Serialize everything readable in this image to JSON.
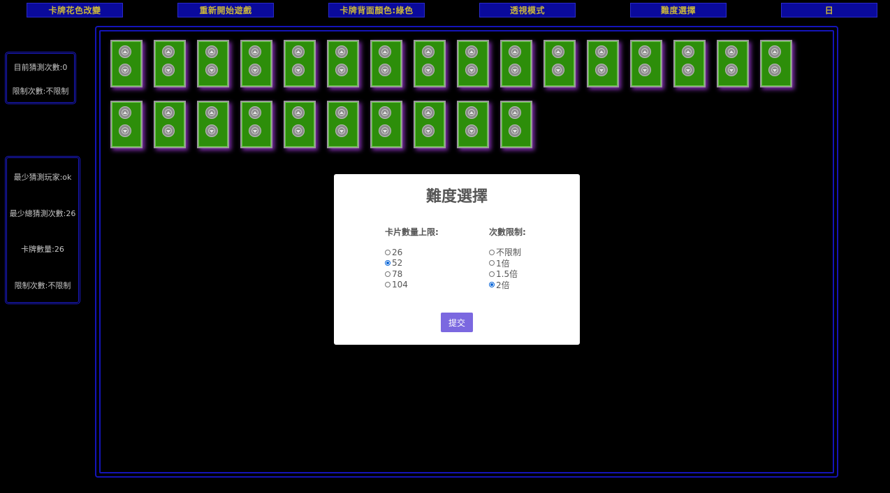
{
  "toolbar": {
    "buttons": [
      {
        "label": "卡牌花色改變"
      },
      {
        "label": "重新開始遊戲"
      },
      {
        "label": "卡牌背面顏色:綠色"
      },
      {
        "label": "透視模式"
      },
      {
        "label": "難度選擇"
      },
      {
        "label": "日"
      }
    ]
  },
  "stats_panel": {
    "current_guesses": "目前猜測次數:0",
    "limit": "限制次數:不限制"
  },
  "records_panel": {
    "min_guess_player": "最少猜測玩家:ok",
    "min_total_guesses": "最少總猜測次數:26",
    "card_count": "卡牌數量:26",
    "limit": "限制次數:不限制"
  },
  "board": {
    "card_back_color": "#2d8e0a",
    "card_count": 26,
    "highlight_color": "#aa3ce6"
  },
  "modal": {
    "title": "難度選擇",
    "card_limit": {
      "label": "卡片數量上限:",
      "options": [
        "26",
        "52",
        "78",
        "104"
      ],
      "selected": "52"
    },
    "guess_limit": {
      "label": "次數限制:",
      "options": [
        "不限制",
        "1倍",
        "1.5倍",
        "2倍"
      ],
      "selected": "2倍"
    },
    "submit_label": "提交",
    "submit_color": "#7b68e0"
  }
}
